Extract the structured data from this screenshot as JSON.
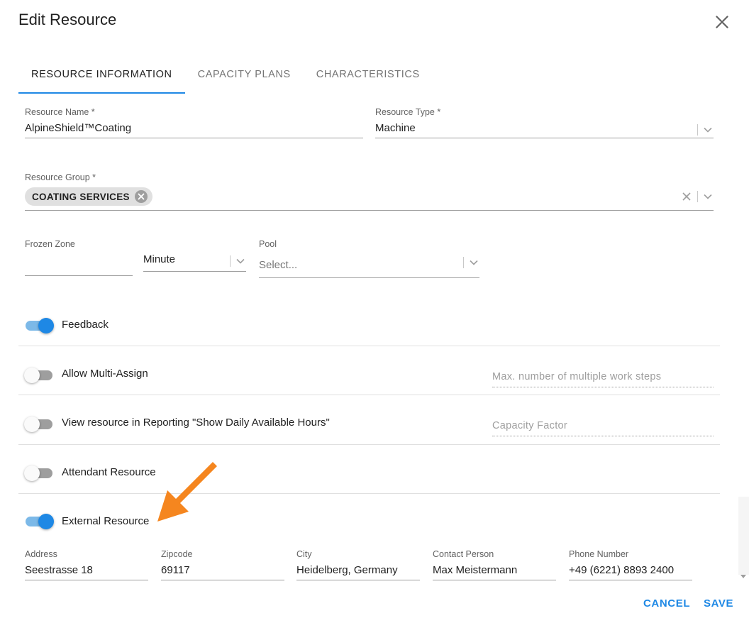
{
  "dialog": {
    "title": "Edit Resource"
  },
  "tabs": [
    {
      "label": "RESOURCE INFORMATION",
      "active": true
    },
    {
      "label": "CAPACITY PLANS",
      "active": false
    },
    {
      "label": "CHARACTERISTICS",
      "active": false
    }
  ],
  "form": {
    "resource_name": {
      "label": "Resource Name *",
      "value": "AlpineShield™Coating"
    },
    "resource_type": {
      "label": "Resource Type *",
      "value": "Machine"
    },
    "resource_group": {
      "label": "Resource Group *",
      "chip": "COATING SERVICES"
    },
    "frozen_zone": {
      "label": "Frozen Zone",
      "value": ""
    },
    "frozen_unit": {
      "value": "Minute"
    },
    "pool": {
      "label": "Pool",
      "placeholder": "Select..."
    }
  },
  "toggles": [
    {
      "label": "Feedback",
      "on": true
    },
    {
      "label": "Allow Multi-Assign",
      "on": false,
      "side_placeholder": "Max. number of multiple work steps"
    },
    {
      "label": "View resource in Reporting \"Show Daily Available Hours\"",
      "on": false,
      "side_placeholder": "Capacity Factor"
    },
    {
      "label": "Attendant Resource",
      "on": false
    },
    {
      "label": "External Resource",
      "on": true
    }
  ],
  "external": {
    "address": {
      "label": "Address",
      "value": "Seestrasse 18"
    },
    "zipcode": {
      "label": "Zipcode",
      "value": "69117"
    },
    "city": {
      "label": "City",
      "value": "Heidelberg, Germany"
    },
    "contact": {
      "label": "Contact Person",
      "value": "Max Meistermann"
    },
    "phone": {
      "label": "Phone Number",
      "value": "+49 (6221) 8893 2400"
    }
  },
  "footer": {
    "cancel": "CANCEL",
    "save": "SAVE"
  },
  "colors": {
    "accent": "#1e88e5",
    "annotation_arrow": "#f5861f"
  }
}
